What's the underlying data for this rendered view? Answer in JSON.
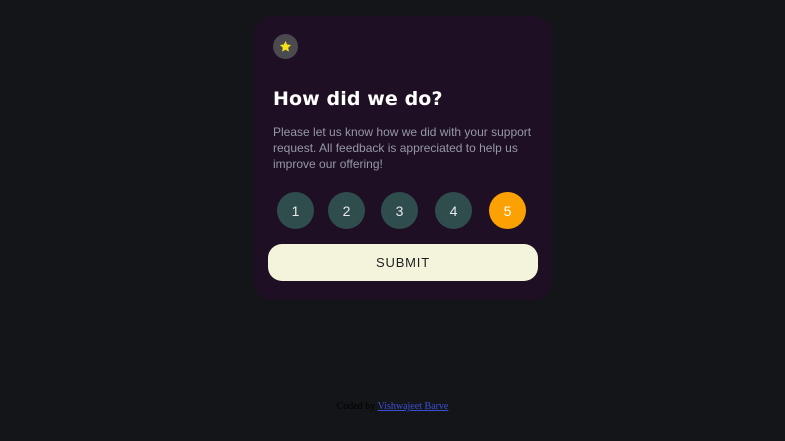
{
  "card": {
    "icon": "star-icon",
    "title": "How did we do?",
    "description": "Please let us know how we did with your support request. All feedback is appreciated to help us improve our offering!",
    "ratings": [
      {
        "label": "1",
        "selected": false
      },
      {
        "label": "2",
        "selected": false
      },
      {
        "label": "3",
        "selected": false
      },
      {
        "label": "4",
        "selected": false
      },
      {
        "label": "5",
        "selected": true
      }
    ],
    "submit_label": "SUBMIT"
  },
  "footer": {
    "prefix": "Coded by",
    "author": "Vishwajeet Barve"
  },
  "colors": {
    "background": "#131518",
    "card": "#1f0f24",
    "rating_default": "#2f4d4d",
    "rating_selected": "#fca103",
    "submit_bg": "#f4f4dc",
    "star": "#f5e11a"
  }
}
